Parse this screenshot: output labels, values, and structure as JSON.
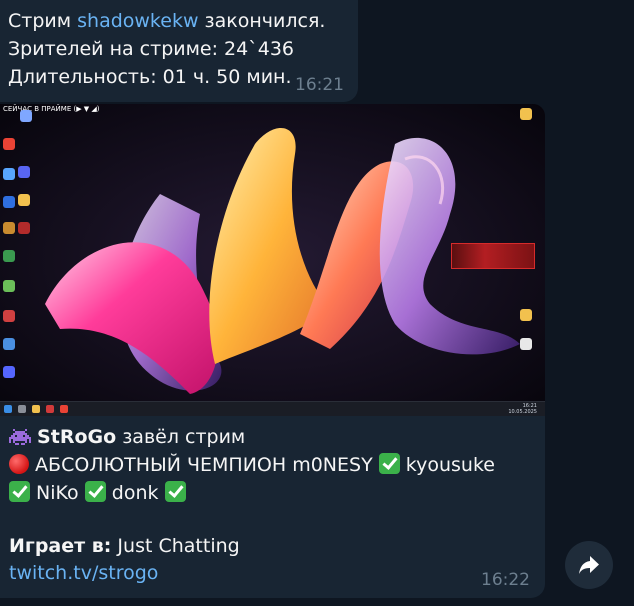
{
  "message1": {
    "line1_prefix": "Стрим ",
    "channel": "shadowkekw",
    "line1_suffix": " закончился.",
    "viewers": "Зрителей на стриме: 24`436",
    "duration": "Длительность: 01 ч. 50 мин.",
    "time": "16:21"
  },
  "message2": {
    "media": {
      "overlay_text": "СЕЙЧАС В ПРАЙМЕ (▶ ▼ ◢)",
      "clock": "16:21",
      "date": "10.05.2025"
    },
    "streamer": "StRoGo",
    "started_text": " завёл стрим",
    "title_part1": " АБСОЛЮТНЫЙ ЧЕМПИОН m0NESY ",
    "title_part2": " kyousuke",
    "title_part3": " NiKo ",
    "title_part4": " donk ",
    "game_label": "Играет в:",
    "game": " Just Chatting",
    "link": "twitch.tv/strogo",
    "time": "16:22"
  },
  "colors": {
    "background": "#0e1621",
    "bubble": "#182533",
    "link": "#6ab3f3",
    "time": "#6d7f8f",
    "check": "#3bb14a"
  },
  "icons": {
    "share": "share-arrow-icon",
    "red_circle": "red-circle-icon",
    "check": "check-mark-icon",
    "invader": "alien-monster-icon"
  }
}
